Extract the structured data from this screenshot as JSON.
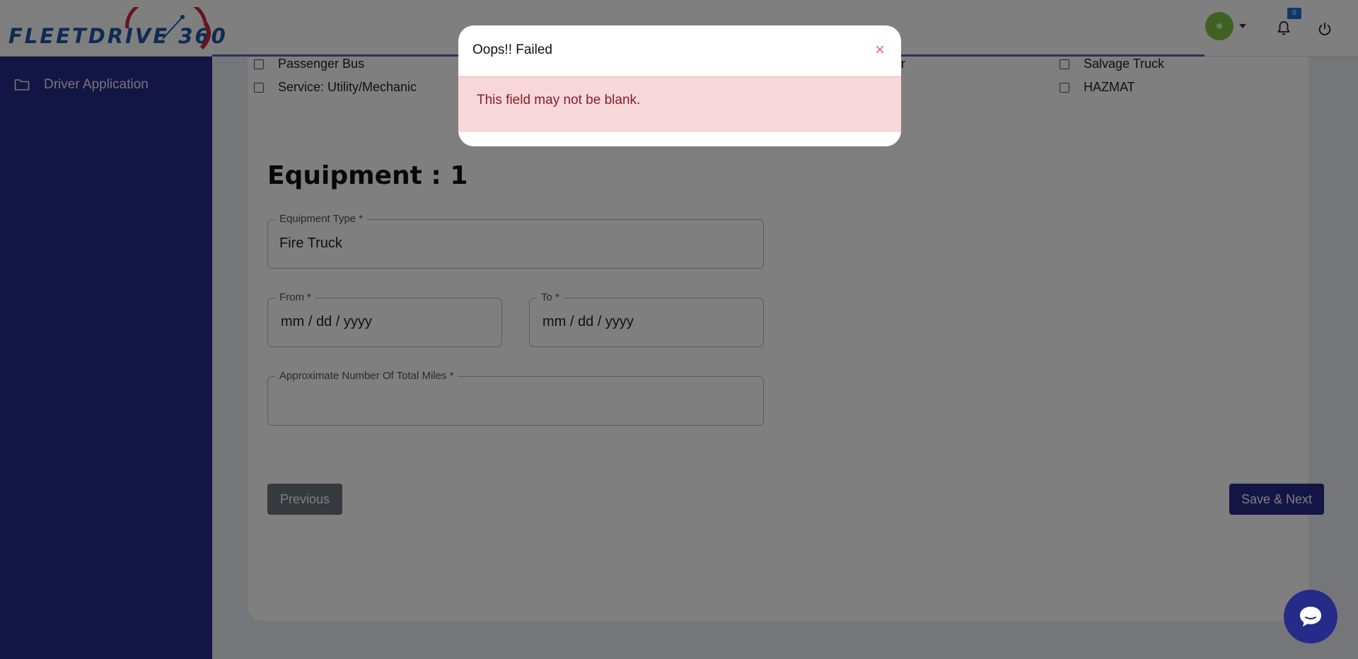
{
  "header": {
    "logo_text": "FLEETDRIVE 360",
    "notification_count": "0",
    "avatar_color": "#7fc244",
    "icons": [
      "user-avatar-icon",
      "chevron-down-icon",
      "bell-icon",
      "power-icon"
    ]
  },
  "sidebar": {
    "items": [
      {
        "label": "Driver Application",
        "icon": "folder-icon"
      }
    ],
    "bg_color": "#262b89"
  },
  "form": {
    "checkboxes": [
      {
        "label": "Passenger Bus",
        "checked": false
      },
      {
        "label": "Service: Utility/Mechanic",
        "checked": false
      },
      {
        "label": "er",
        "checked": false
      },
      {
        "label": "Salvage Truck",
        "checked": false
      },
      {
        "label": "HAZMAT",
        "checked": false
      }
    ],
    "section_title": "Equipment : 1",
    "equipment_type": {
      "label": "Equipment Type *",
      "value": "Fire Truck"
    },
    "from": {
      "label": "From *",
      "value": "mm / dd / yyyy"
    },
    "to": {
      "label": "To *",
      "value": "mm / dd / yyyy"
    },
    "miles": {
      "label": "Approximate Number Of Total Miles *",
      "value": ""
    },
    "previous_label": "Previous",
    "next_label": "Save & Next"
  },
  "modal": {
    "title": "Oops!! Failed",
    "close_symbol": "×",
    "message": "This field may not be blank.",
    "alert_bg": "#f8d7da",
    "alert_text_color": "#842029"
  },
  "chat": {
    "icon": "chat-bubble-icon"
  }
}
